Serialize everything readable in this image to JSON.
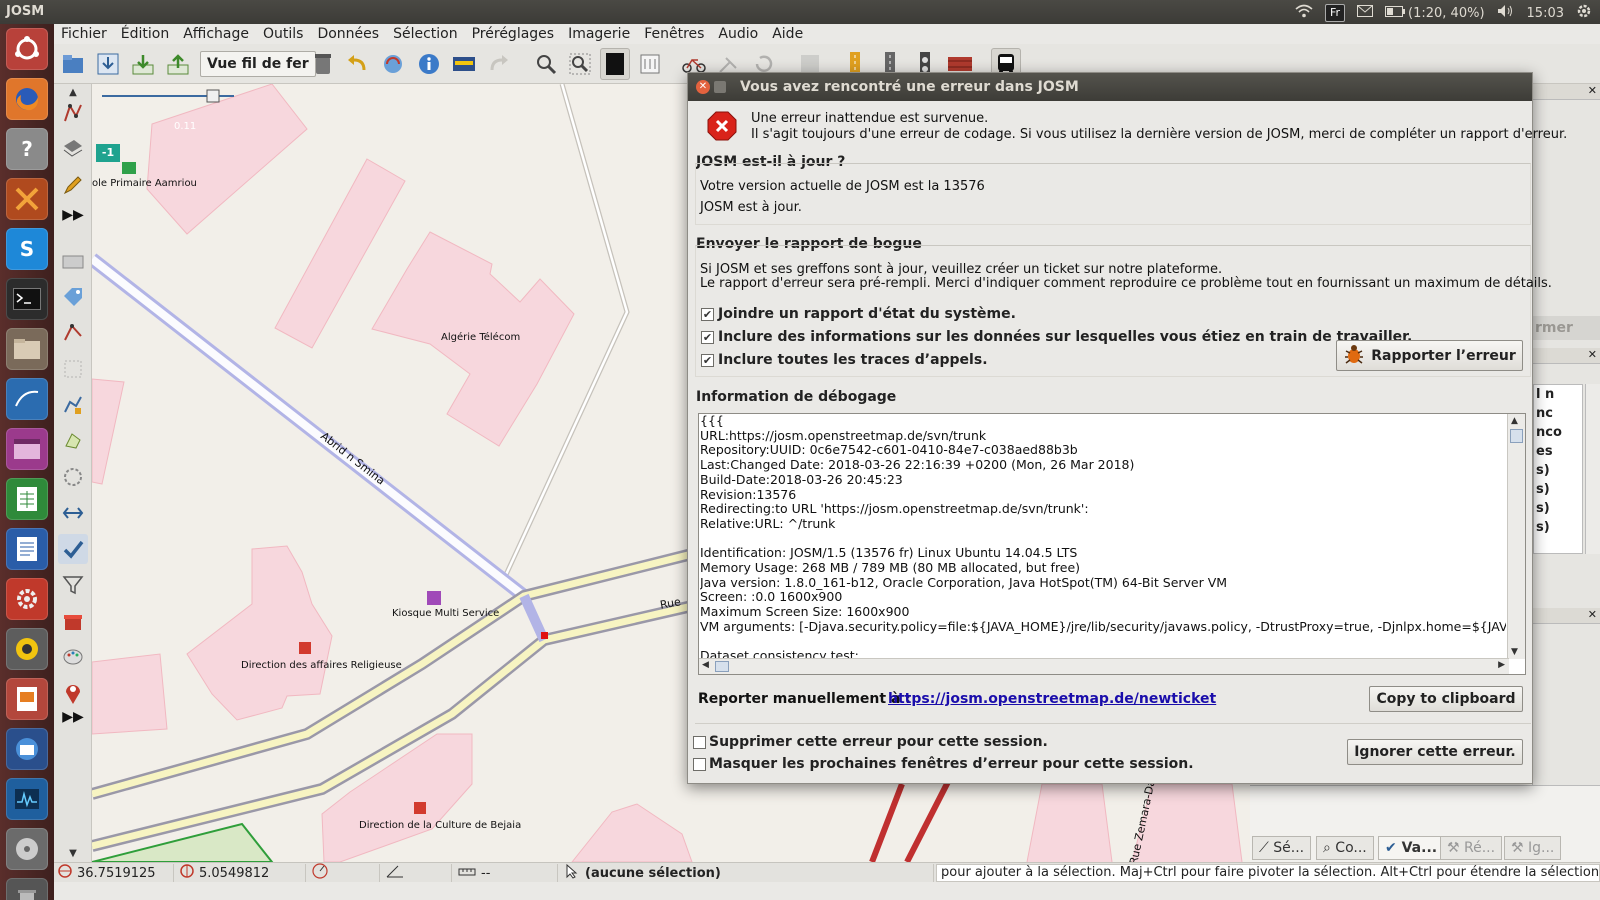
{
  "app": {
    "title": "JOSM"
  },
  "tray": {
    "keyboard": "Fr",
    "battery": "(1:20, 40%)",
    "clock": "15:03"
  },
  "menubar": [
    "Fichier",
    "Édition",
    "Affichage",
    "Outils",
    "Données",
    "Sélection",
    "Préréglages",
    "Imagerie",
    "Fenêtres",
    "Audio",
    "Aide"
  ],
  "toolbar": {
    "wireframe_label": "Vue fil de fer"
  },
  "map": {
    "layer_badge": "-1",
    "scale_text": "0.11",
    "labels": {
      "school": "ole Primaire Aamriou",
      "algerie_telecom": "Algérie Télécom",
      "road": "Abrid n Smina",
      "kiosque": "Kiosque Multi Service",
      "rue": "Rue",
      "religious": "Direction des affaires Religieuse",
      "culture": "Direction de la Culture de Bejaia",
      "zemara": "Rue Zemara-Dal"
    }
  },
  "right_panel": {
    "partial_texts": [
      "rmer",
      "l n",
      "nc",
      "nco",
      "es",
      "s)",
      "s)",
      "s)",
      "s)"
    ],
    "tabs": [
      "Sé...",
      "Co...",
      "Va...",
      "Ré...",
      "Ig..."
    ]
  },
  "statusbar": {
    "lat": "36.7519125",
    "lon": "5.0549812",
    "heading": "",
    "angle": "",
    "distance": "--",
    "selection": "(aucune sélection)",
    "help": "pour ajouter à la sélection. Maj+Ctrl pour faire pivoter la sélection. Alt+Ctrl pour étendre la sélection."
  },
  "dialog": {
    "title": "Vous avez rencontré une erreur dans JOSM",
    "error_line1": "Une erreur inattendue est survenue.",
    "error_line2": "Il s'agit toujours d'une erreur de codage. Si vous utilisez la dernière version de JOSM, merci de compléter un rapport d'erreur.",
    "uptodate_title": "JOSM est-il à jour ?",
    "version_line": "Votre version actuelle de JOSM est la 13576",
    "uptodate_line": "JOSM est à jour.",
    "send_title": "Envoyer le rapport de bogue",
    "send_line1": "Si JOSM et ses greffons sont à jour, veuillez créer un ticket sur notre plateforme.",
    "send_line2": "Le rapport d'erreur sera pré-rempli. Merci d'indiquer comment reproduire ce problème tout en fournissant un maximum de détails.",
    "checkboxes": [
      {
        "label": "Joindre un rapport d'état du système.",
        "checked": true
      },
      {
        "label": "Inclure des informations sur les données sur lesquelles vous étiez en train de travailler.",
        "checked": true
      },
      {
        "label": "Inclure toutes les traces d’appels.",
        "checked": true
      }
    ],
    "report_button": "Rapporter l’erreur",
    "debug_title": "Information de débogage",
    "debug_lines": [
      "{{{",
      "URL:https://josm.openstreetmap.de/svn/trunk",
      "Repository:UUID: 0c6e7542-c601-0410-84e7-c038aed88b3b",
      "Last:Changed Date: 2018-03-26 22:16:39 +0200 (Mon, 26 Mar 2018)",
      "Build-Date:2018-03-26 20:45:23",
      "Revision:13576",
      "Redirecting:to URL 'https://josm.openstreetmap.de/svn/trunk':",
      "Relative:URL: ^/trunk",
      "",
      "Identification: JOSM/1.5 (13576 fr) Linux Ubuntu 14.04.5 LTS",
      "Memory Usage: 268 MB / 789 MB (80 MB allocated, but free)",
      "Java version: 1.8.0_161-b12, Oracle Corporation, Java HotSpot(TM) 64-Bit Server VM",
      "Screen: :0.0 1600x900",
      "Maximum Screen Size: 1600x900",
      "VM arguments: [-Djava.security.policy=file:${JAVA_HOME}/jre/lib/security/javaws.policy, -DtrustProxy=true, -Djnlpx.home=${JAVA_HOM",
      "",
      "Dataset consistency test:"
    ],
    "manual_label": "Reporter manuellement à :",
    "manual_link": "https://josm.openstreetmap.de/newticket",
    "copy_button": "Copy to clipboard",
    "suppress_session": "Supprimer cette erreur pour cette session.",
    "hide_next": "Masquer les prochaines fenêtres d’erreur pour cette session.",
    "ignore_button": "Ignorer cette erreur."
  }
}
